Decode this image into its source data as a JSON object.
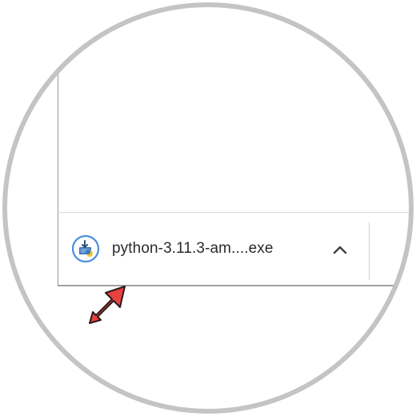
{
  "download_bar": {
    "file_name": "python-3.11.3-am....exe",
    "file_icon": "python-installer-icon",
    "menu_icon": "chevron-up-icon"
  },
  "annotation": {
    "icon": "red-arrow-pointer",
    "color": "#e8423f"
  },
  "frame": {
    "ring_color": "#c4c4c4"
  }
}
